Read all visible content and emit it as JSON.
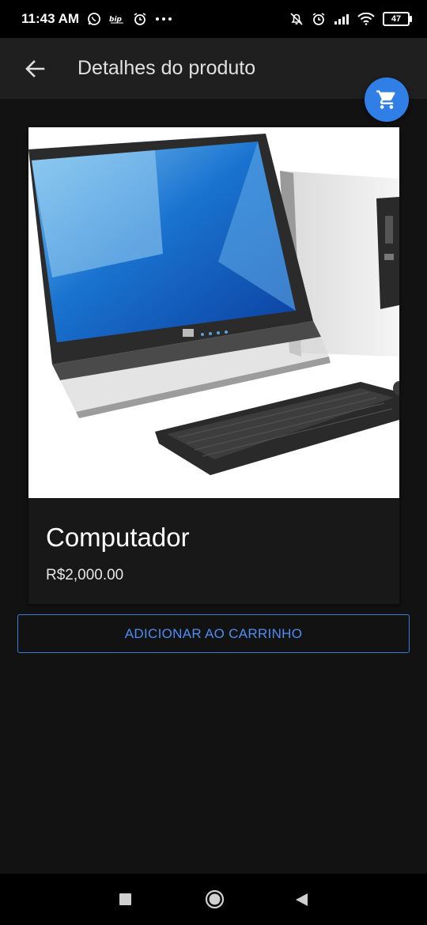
{
  "status_bar": {
    "time": "11:43 AM",
    "left_icons": [
      "whatsapp-icon",
      "signal-app-icon",
      "alarm-icon",
      "more-dots-icon"
    ],
    "right_icons": [
      "bell-off-icon",
      "alarm-icon",
      "cell-signal-icon",
      "wifi-icon"
    ],
    "battery": "47"
  },
  "app_bar": {
    "title": "Detalhes do produto",
    "back_icon": "arrow-left-icon"
  },
  "cart_fab": {
    "icon": "shopping-cart-icon",
    "color": "#2f7fe6"
  },
  "product": {
    "name": "Computador",
    "price": "R$2,000.00",
    "image": "desktop-computer-photo"
  },
  "actions": {
    "add_to_cart": "ADICIONAR AO CARRINHO",
    "accent": "#4c8ef0"
  },
  "nav_bar": {
    "icons": [
      "recents-square-icon",
      "home-circle-icon",
      "back-triangle-icon"
    ]
  }
}
